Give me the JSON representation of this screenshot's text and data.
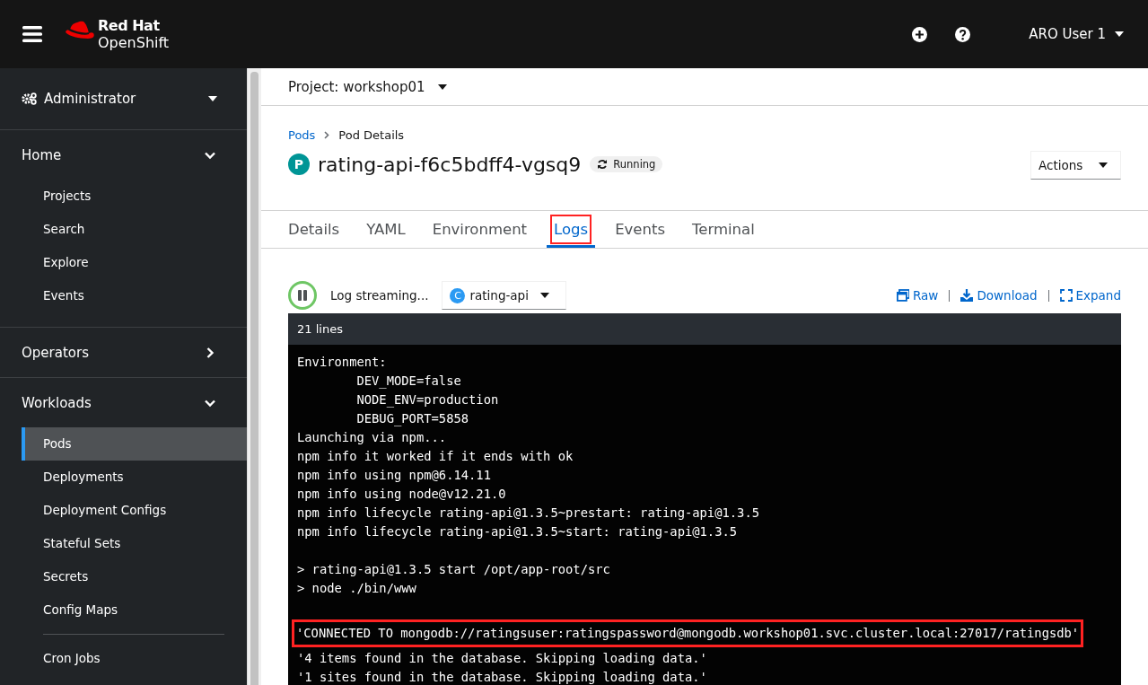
{
  "masthead": {
    "brand_top": "Red Hat",
    "brand_bottom": "OpenShift",
    "user": "ARO User 1"
  },
  "sidebar": {
    "perspective": "Administrator",
    "sections": [
      {
        "label": "Home",
        "expanded": true,
        "items": [
          {
            "label": "Projects",
            "selected": false
          },
          {
            "label": "Search",
            "selected": false
          },
          {
            "label": "Explore",
            "selected": false
          },
          {
            "label": "Events",
            "selected": false
          }
        ]
      },
      {
        "label": "Operators",
        "expanded": false
      },
      {
        "label": "Workloads",
        "expanded": true,
        "items": [
          {
            "label": "Pods",
            "selected": true
          },
          {
            "label": "Deployments",
            "selected": false
          },
          {
            "label": "Deployment Configs",
            "selected": false
          },
          {
            "label": "Stateful Sets",
            "selected": false
          },
          {
            "label": "Secrets",
            "selected": false
          },
          {
            "label": "Config Maps",
            "selected": false
          },
          {
            "label": "Cron Jobs",
            "selected": false,
            "divider_before": true
          }
        ]
      }
    ]
  },
  "project": "Project: workshop01",
  "breadcrumb": [
    {
      "label": "Pods",
      "link": true
    },
    {
      "label": "Pod Details",
      "link": false
    }
  ],
  "pod": {
    "badge": "P",
    "name": "rating-api-f6c5bdff4-vgsq9",
    "status": "Running"
  },
  "actions": "Actions",
  "tabs": [
    {
      "label": "Details",
      "selected": false,
      "highlighted": false
    },
    {
      "label": "YAML",
      "selected": false,
      "highlighted": false
    },
    {
      "label": "Environment",
      "selected": false,
      "highlighted": false
    },
    {
      "label": "Logs",
      "selected": true,
      "highlighted": true
    },
    {
      "label": "Events",
      "selected": false,
      "highlighted": false
    },
    {
      "label": "Terminal",
      "selected": false,
      "highlighted": false
    }
  ],
  "log_toolbar": {
    "streaming": "Log streaming...",
    "container_badge": "C",
    "container": "rating-api",
    "links": [
      {
        "kind": "raw",
        "label": "Raw"
      },
      {
        "kind": "download",
        "label": "Download"
      },
      {
        "kind": "expand",
        "label": "Expand"
      }
    ]
  },
  "log": {
    "line_count": "21 lines",
    "lines": [
      {
        "kind": "text",
        "text": "Environment:",
        "highlighted": false
      },
      {
        "kind": "text",
        "text": "\tDEV_MODE=false",
        "highlighted": false
      },
      {
        "kind": "text",
        "text": "\tNODE_ENV=production",
        "highlighted": false
      },
      {
        "kind": "text",
        "text": "\tDEBUG_PORT=5858",
        "highlighted": false
      },
      {
        "kind": "text",
        "text": "Launching via npm...",
        "highlighted": false
      },
      {
        "kind": "text",
        "text": "npm info it worked if it ends with ok",
        "highlighted": false
      },
      {
        "kind": "text",
        "text": "npm info using npm@6.14.11",
        "highlighted": false
      },
      {
        "kind": "text",
        "text": "npm info using node@v12.21.0",
        "highlighted": false
      },
      {
        "kind": "text",
        "text": "npm info lifecycle rating-api@1.3.5~prestart: rating-api@1.3.5",
        "highlighted": false
      },
      {
        "kind": "text",
        "text": "npm info lifecycle rating-api@1.3.5~start: rating-api@1.3.5",
        "highlighted": false
      },
      {
        "kind": "blank"
      },
      {
        "kind": "text",
        "text": "> rating-api@1.3.5 start /opt/app-root/src",
        "highlighted": false
      },
      {
        "kind": "text",
        "text": "> node ./bin/www",
        "highlighted": false
      },
      {
        "kind": "blank"
      },
      {
        "kind": "text",
        "text": "'CONNECTED TO mongodb://ratingsuser:ratingspassword@mongodb.workshop01.svc.cluster.local:27017/ratingsdb'",
        "highlighted": true
      },
      {
        "kind": "text",
        "text": "'4 items found in the database. Skipping loading data.'",
        "highlighted": false
      },
      {
        "kind": "text",
        "text": "'1 sites found in the database. Skipping loading data.'",
        "highlighted": false
      }
    ]
  }
}
